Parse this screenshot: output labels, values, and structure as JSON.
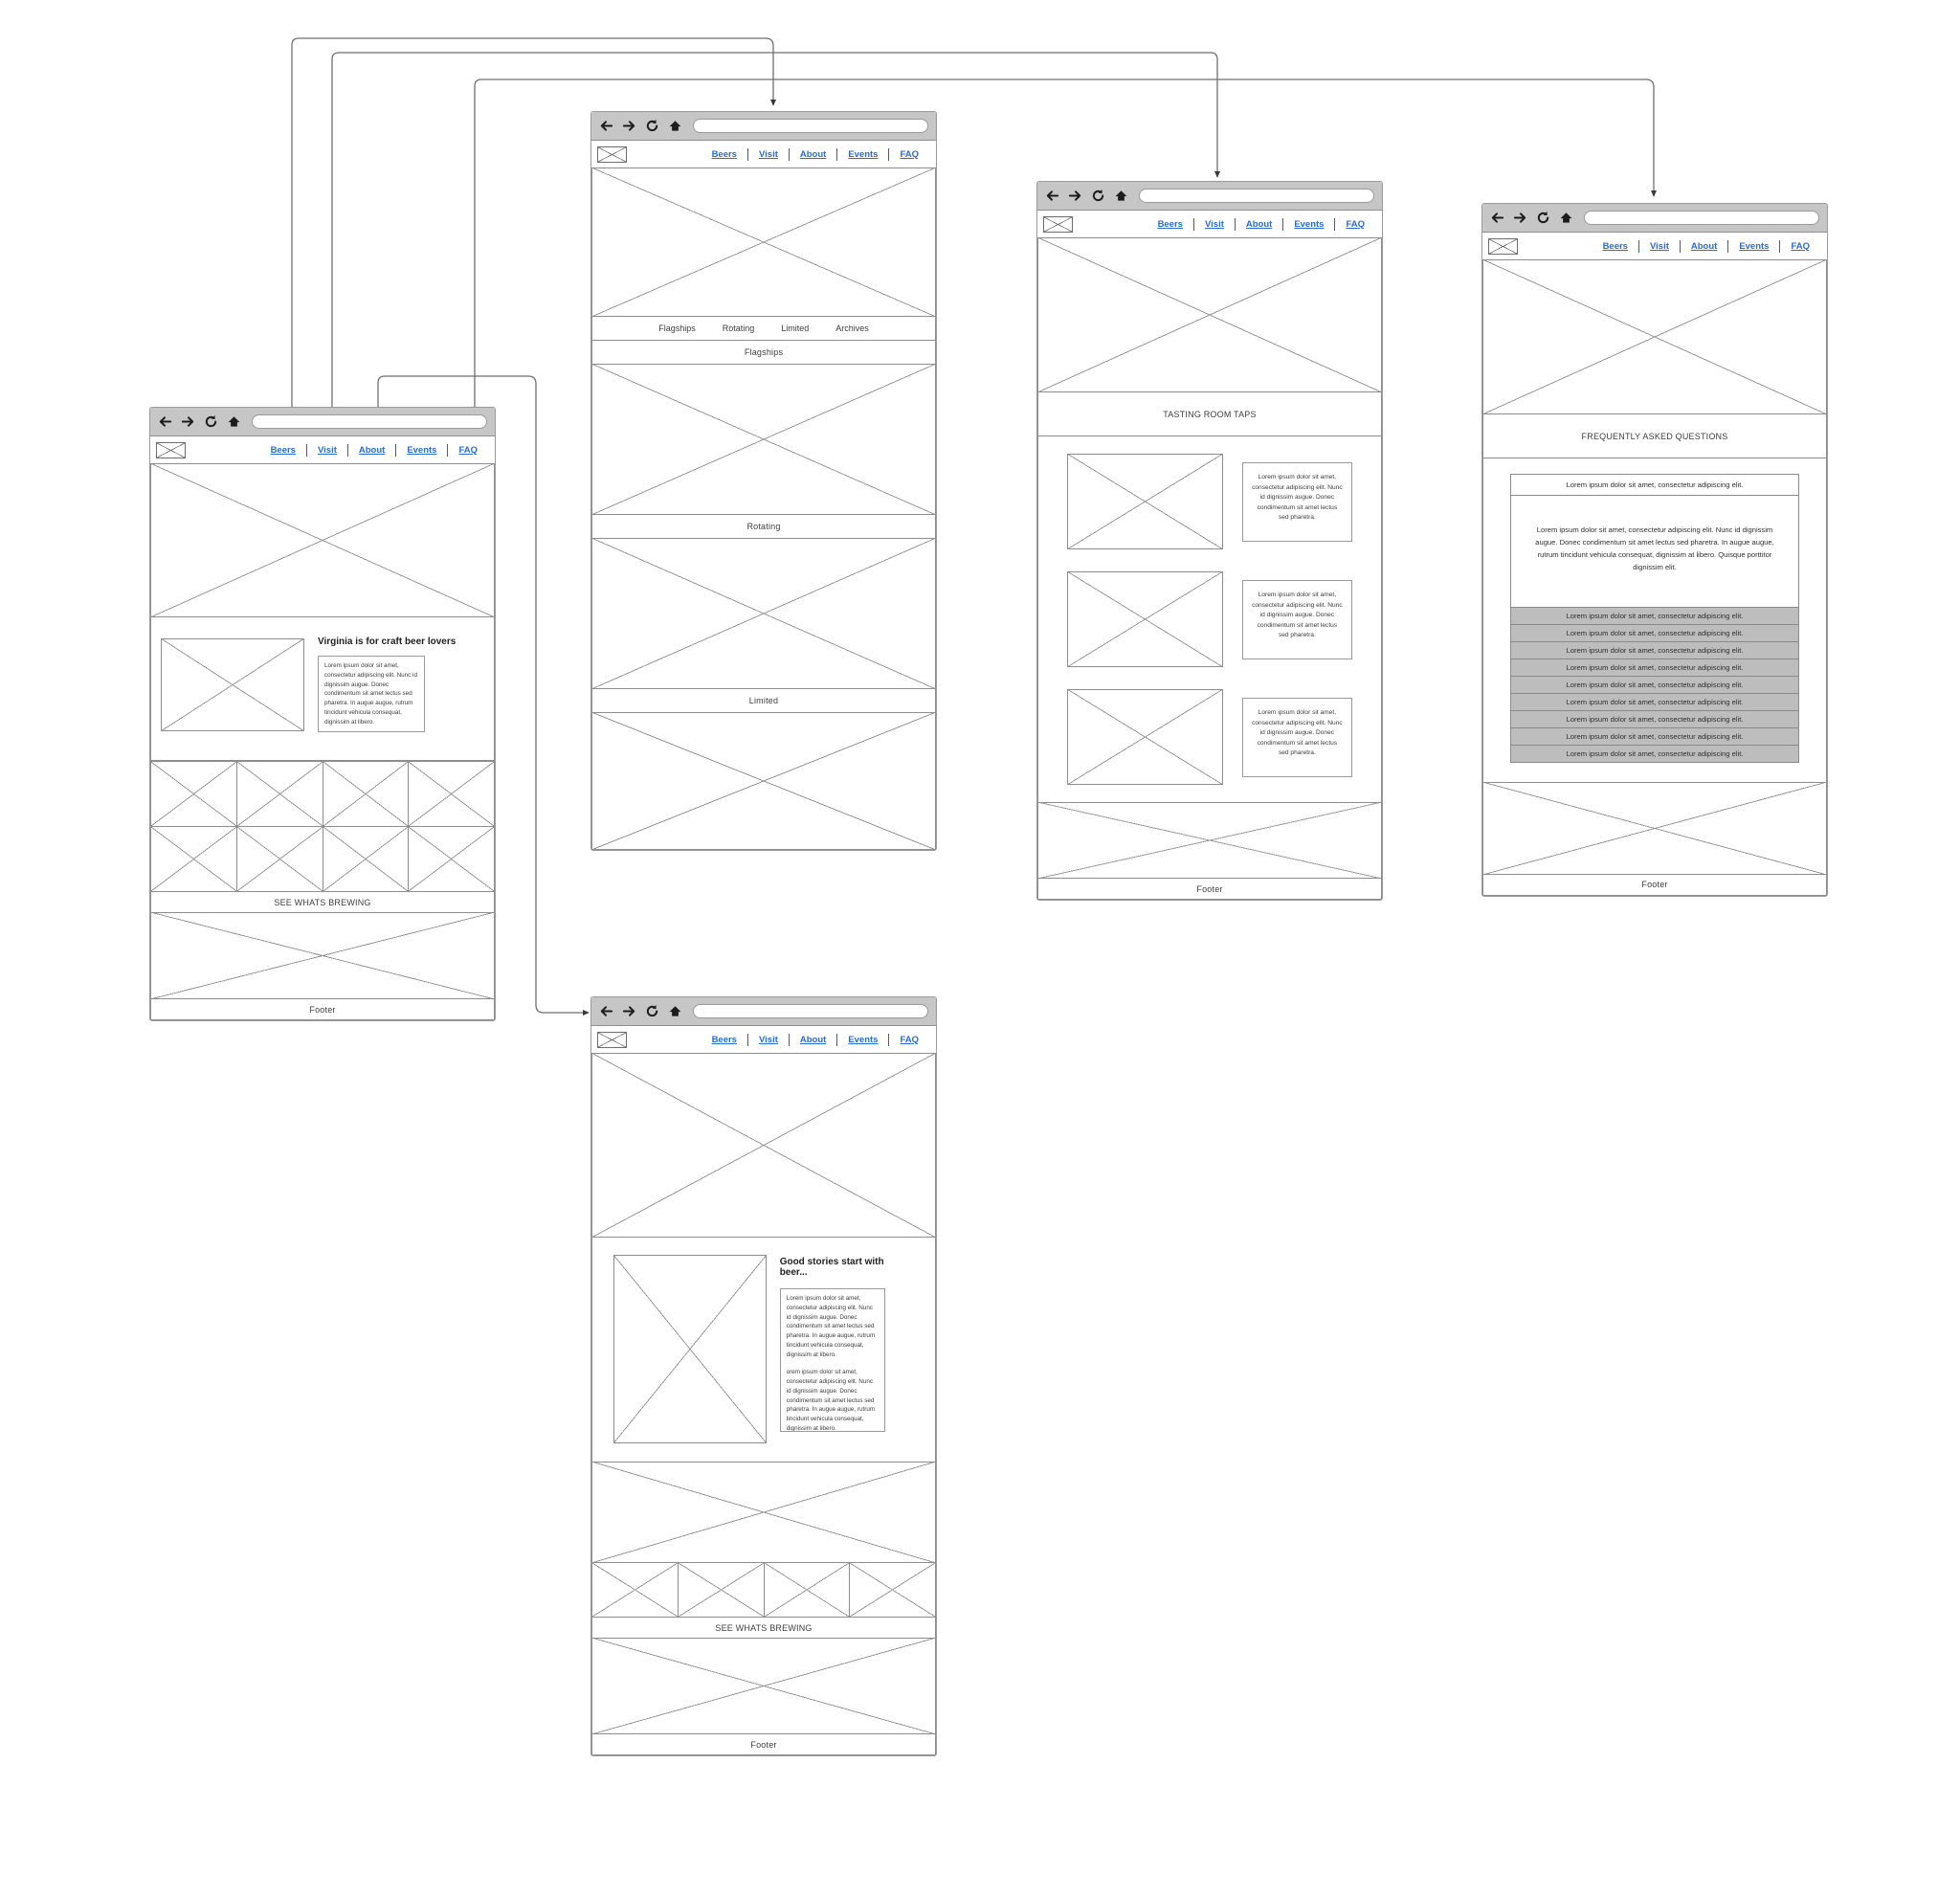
{
  "meta": {
    "doc_title": "Brewery Website Wireframe Sitemap"
  },
  "browser_chrome": {
    "back_icon": "back-arrow-icon",
    "forward_icon": "forward-arrow-icon",
    "reload_icon": "reload-icon",
    "home_icon": "home-icon",
    "url_value": "",
    "url_placeholder": ""
  },
  "nav": {
    "logo": "logo-placeholder",
    "links": [
      "Beers",
      "Visit",
      "About",
      "Events",
      "FAQ"
    ]
  },
  "pages": {
    "home": {
      "name": "Home",
      "intro_heading": "Virginia is for craft beer lovers",
      "intro_copy": "Lorem ipsum dolor sit amet, consectetur adipiscing elit. Nunc id dignissim augue. Donec condimentum sit amet lectus sed pharetra. In augue augue, rutrum tincidunt vehicula consequat, dignissim at libero.",
      "brewing_cta": "SEE WHATS BREWING",
      "footer": "Footer"
    },
    "beers": {
      "name": "Beers",
      "tabs": [
        "Flagships",
        "Rotating",
        "Limited",
        "Archives"
      ],
      "sections": [
        "Flagships",
        "Rotating",
        "Limited"
      ]
    },
    "visit": {
      "name": "Visit",
      "section_title": "TASTING ROOM TAPS",
      "taps": [
        {
          "copy": "Lorem ipsum dolor sit amet, consectetur adipiscing elit. Nunc id dignissim augue. Donec condimentum sit amet lectus sed pharetra."
        },
        {
          "copy": "Lorem ipsum dolor sit amet, consectetur adipiscing elit. Nunc id dignissim augue. Donec condimentum sit amet lectus sed pharetra."
        },
        {
          "copy": "Lorem ipsum dolor sit amet, consectetur adipiscing elit. Nunc id dignissim augue. Donec condimentum sit amet lectus sed pharetra."
        }
      ],
      "footer": "Footer"
    },
    "faq": {
      "name": "FAQ",
      "section_title": "FREQUENTLY ASKED QUESTIONS",
      "open_question": "Lorem ipsum dolor sit amet, consectetur adipiscing elit.",
      "open_answer": "Lorem ipsum dolor sit amet, consectetur adipiscing elit. Nunc id dignissim augue. Donec condimentum sit amet lectus sed pharetra. In augue augue, rutrum tincidunt vehicula consequat, dignissim at libero. Quisque porttitor dignissim elit.",
      "collapsed_questions": [
        "Lorem ipsum dolor sit amet, consectetur adipiscing elit.",
        "Lorem ipsum dolor sit amet, consectetur adipiscing elit.",
        "Lorem ipsum dolor sit amet, consectetur adipiscing elit.",
        "Lorem ipsum dolor sit amet, consectetur adipiscing elit.",
        "Lorem ipsum dolor sit amet, consectetur adipiscing elit.",
        "Lorem ipsum dolor sit amet, consectetur adipiscing elit.",
        "Lorem ipsum dolor sit amet, consectetur adipiscing elit.",
        "Lorem ipsum dolor sit amet, consectetur adipiscing elit.",
        "Lorem ipsum dolor sit amet, consectetur adipiscing elit."
      ],
      "footer": "Footer"
    },
    "about": {
      "name": "About",
      "intro_heading": "Good stories start with beer...",
      "intro_copy_1": "Lorem ipsum dolor sit amet, consectetur adipiscing elit. Nunc id dignissim augue. Donec condimentum sit amet lectus sed pharetra. In augue augue, rutrum tincidunt vehicula consequat, dignissim at libero.",
      "intro_copy_2": "orem ipsum dolor sit amet, consectetur adipiscing elit. Nunc id dignissim augue. Donec condimentum sit amet lectus sed pharetra. In augue augue, rutrum tincidunt vehicula consequat, dignissim at libero.",
      "brewing_cta": "SEE WHATS BREWING",
      "footer": "Footer"
    }
  },
  "colors": {
    "link": "#2a6bd4",
    "chrome": "#c6c6c6",
    "outline": "#8d8d8d",
    "faq_row": "#bdbdbd"
  }
}
